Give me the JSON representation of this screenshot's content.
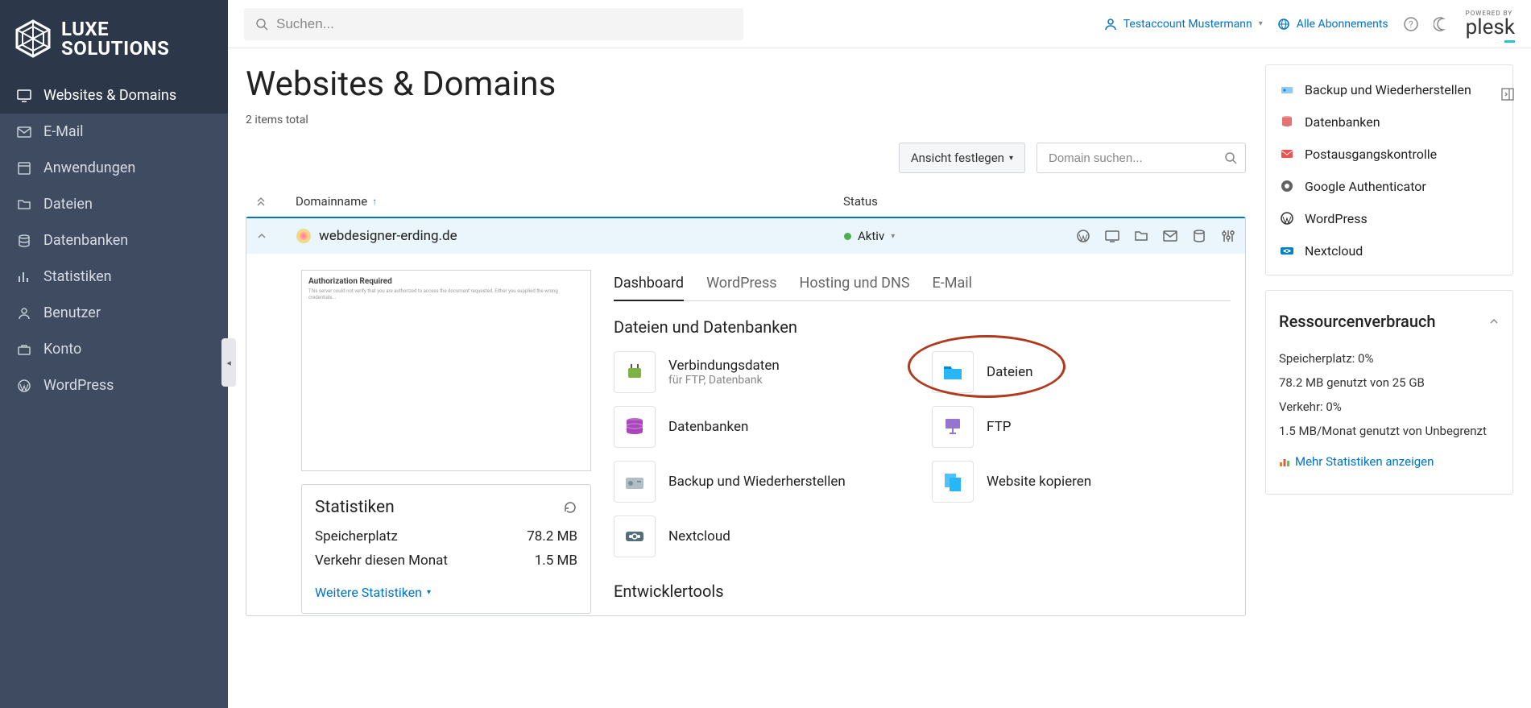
{
  "brand": {
    "line1": "LUXE",
    "line2": "SOLUTIONS"
  },
  "nav": [
    {
      "label": "Websites & Domains",
      "icon": "monitor"
    },
    {
      "label": "E-Mail",
      "icon": "mail"
    },
    {
      "label": "Anwendungen",
      "icon": "app"
    },
    {
      "label": "Dateien",
      "icon": "folder"
    },
    {
      "label": "Datenbanken",
      "icon": "db"
    },
    {
      "label": "Statistiken",
      "icon": "stats"
    },
    {
      "label": "Benutzer",
      "icon": "user"
    },
    {
      "label": "Konto",
      "icon": "suitcase"
    },
    {
      "label": "WordPress",
      "icon": "wp"
    }
  ],
  "topbar": {
    "search_placeholder": "Suchen...",
    "account": "Testaccount Mustermann",
    "subscriptions": "Alle Abonnements",
    "plesk_pb": "POWERED BY",
    "plesk": "plesk"
  },
  "page": {
    "title": "Websites & Domains",
    "items_total": "2 items total",
    "view_btn": "Ansicht festlegen",
    "domain_search_placeholder": "Domain suchen...",
    "columns": {
      "domain": "Domainname",
      "status": "Status"
    }
  },
  "domain": {
    "name": "webdesigner-erding.de",
    "status": "Aktiv",
    "tabs": [
      "Dashboard",
      "WordPress",
      "Hosting und DNS",
      "E-Mail"
    ],
    "section_files": "Dateien und Datenbanken",
    "tools": [
      {
        "name": "Verbindungsdaten",
        "sub": "für FTP, Datenbank",
        "icon": "plug"
      },
      {
        "name": "Dateien",
        "icon": "folder-blue",
        "highlight": true
      },
      {
        "name": "Datenbanken",
        "icon": "db-purple"
      },
      {
        "name": "FTP",
        "icon": "ftp"
      },
      {
        "name": "Backup und Wiederherstellen",
        "icon": "drive"
      },
      {
        "name": "Website kopieren",
        "icon": "copy"
      },
      {
        "name": "Nextcloud",
        "icon": "nextcloud"
      }
    ],
    "section_dev": "Entwicklertools",
    "preview_title": "Authorization Required",
    "stats": {
      "title": "Statistiken",
      "storage_label": "Speicherplatz",
      "storage_val": "78.2 MB",
      "traffic_label": "Verkehr diesen Monat",
      "traffic_val": "1.5 MB",
      "more": "Weitere Statistiken"
    }
  },
  "aside_tools": [
    {
      "name": "Backup und Wiederherstellen",
      "color": "#5b9bd5"
    },
    {
      "name": "Datenbanken",
      "color": "#e06c5c"
    },
    {
      "name": "Postausgangskontrolle",
      "color": "#e85c5c"
    },
    {
      "name": "Google Authenticator",
      "color": "#666"
    },
    {
      "name": "WordPress",
      "color": "#333"
    },
    {
      "name": "Nextcloud",
      "color": "#0082c9"
    }
  ],
  "resources": {
    "title": "Ressourcenverbrauch",
    "rows": [
      "Speicherplatz: 0%",
      "78.2 MB genutzt von 25 GB",
      "Verkehr: 0%",
      "1.5 MB/Monat genutzt von Unbegrenzt"
    ],
    "more": "Mehr Statistiken anzeigen"
  }
}
